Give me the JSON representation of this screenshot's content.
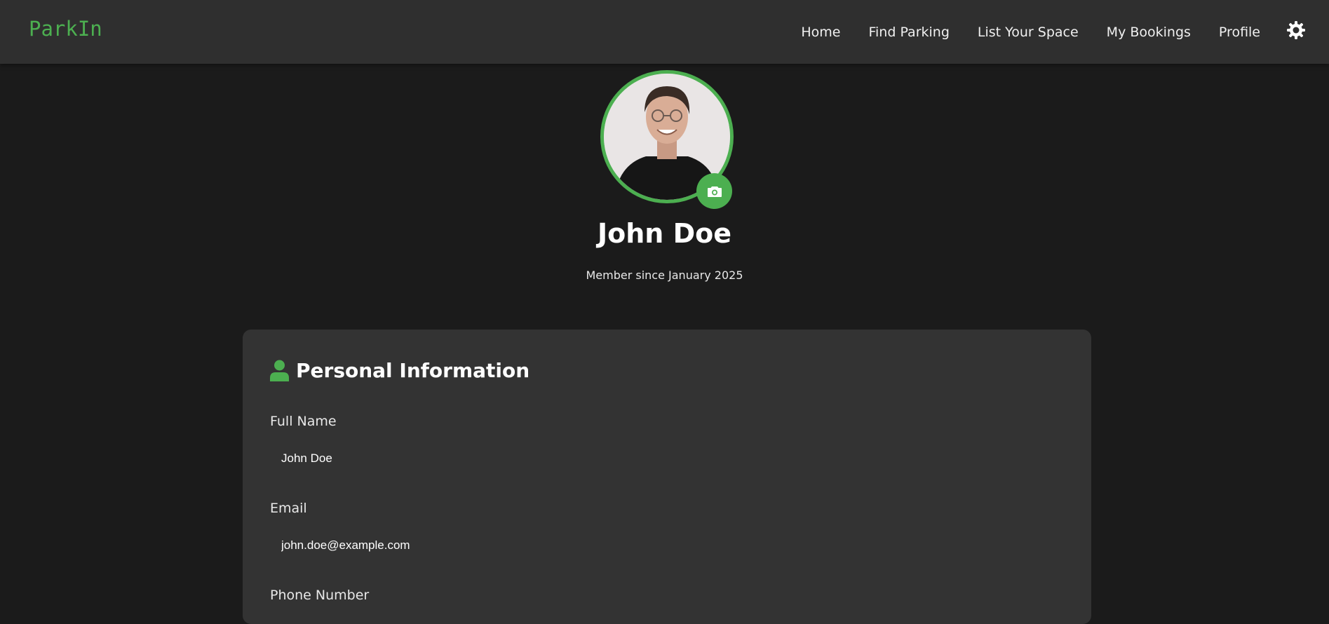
{
  "nav": {
    "logo": "ParkIn",
    "links": [
      "Home",
      "Find Parking",
      "List Your Space",
      "My Bookings",
      "Profile"
    ],
    "theme_icon": "gear-icon"
  },
  "profile": {
    "name": "John Doe",
    "member_since": "Member since January 2025",
    "avatar_icon": "profile-photo",
    "camera_icon": "camera-icon"
  },
  "personal_info": {
    "title": "Personal Information",
    "icon": "user-icon",
    "fields": {
      "full_name": {
        "label": "Full Name",
        "value": "John Doe"
      },
      "email": {
        "label": "Email",
        "value": "john.doe@example.com"
      },
      "phone": {
        "label": "Phone Number",
        "value": ""
      }
    }
  },
  "colors": {
    "accent": "#4caf50",
    "background": "#1b1b1b",
    "navbar": "#2f2f2f",
    "card": "#333333"
  }
}
